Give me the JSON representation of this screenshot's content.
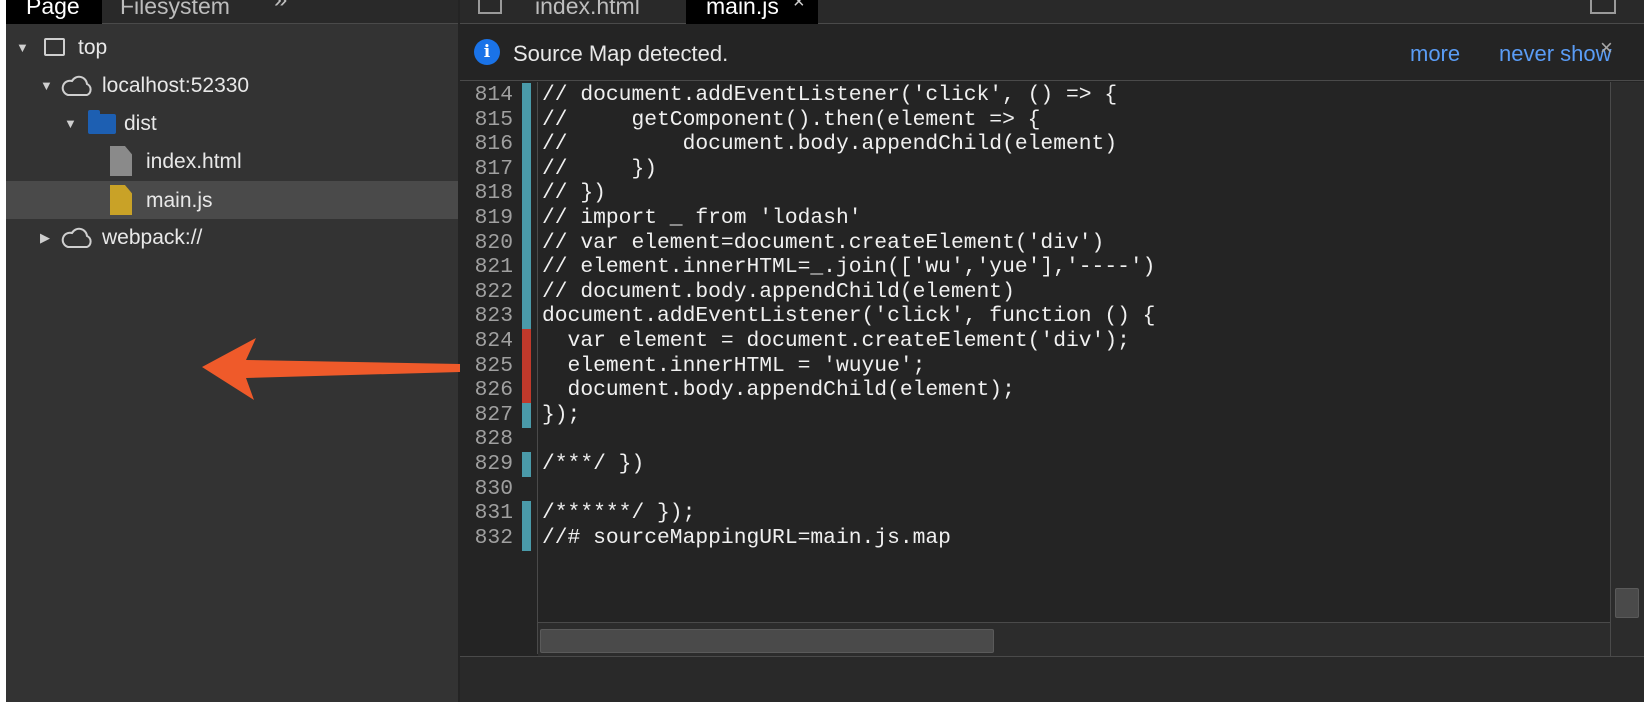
{
  "navigator": {
    "tabs": [
      "Page",
      "Filesystem"
    ],
    "more_label": "»",
    "menu_label": "⋮",
    "tree": [
      {
        "label": "top",
        "icon": "frame-icon",
        "expanded": true
      },
      {
        "label": "localhost:52330",
        "icon": "cloud-icon",
        "expanded": true
      },
      {
        "label": "dist",
        "icon": "folder-icon",
        "expanded": true
      },
      {
        "label": "index.html",
        "icon": "file-icon"
      },
      {
        "label": "main.js",
        "icon": "file-icon",
        "selected": true
      },
      {
        "label": "webpack://",
        "icon": "cloud-icon",
        "expanded": false
      }
    ],
    "tri_down": "▼",
    "tri_right": "▶"
  },
  "editor": {
    "tabs": [
      {
        "label": "index.html"
      },
      {
        "label": "main.js",
        "active": true
      }
    ],
    "close_label": "×",
    "infobar": {
      "icon": "i",
      "message": "Source Map detected.",
      "more_label": "more",
      "never_label": "never show",
      "close_label": "×"
    },
    "lines": [
      {
        "no": "814",
        "text": "// document.addEventListener('click', () => {",
        "marker": "teal"
      },
      {
        "no": "815",
        "text": "//     getComponent().then(element => {",
        "marker": "teal"
      },
      {
        "no": "816",
        "text": "//         document.body.appendChild(element)",
        "marker": "teal"
      },
      {
        "no": "817",
        "text": "//     })",
        "marker": "teal"
      },
      {
        "no": "818",
        "text": "// })",
        "marker": "teal"
      },
      {
        "no": "819",
        "text": "// import _ from 'lodash'",
        "marker": "teal"
      },
      {
        "no": "820",
        "text": "// var element=document.createElement('div')",
        "marker": "teal"
      },
      {
        "no": "821",
        "text": "// element.innerHTML=_.join(['wu','yue'],'----')",
        "marker": "teal"
      },
      {
        "no": "822",
        "text": "// document.body.appendChild(element)",
        "marker": "teal"
      },
      {
        "no": "823",
        "text": "document.addEventListener('click', function () {",
        "marker": "teal"
      },
      {
        "no": "824",
        "text": "  var element = document.createElement('div');",
        "marker": "red"
      },
      {
        "no": "825",
        "text": "  element.innerHTML = 'wuyue';",
        "marker": "red"
      },
      {
        "no": "826",
        "text": "  document.body.appendChild(element);",
        "marker": "red"
      },
      {
        "no": "827",
        "text": "});",
        "marker": "teal"
      },
      {
        "no": "828",
        "text": "",
        "marker": ""
      },
      {
        "no": "829",
        "text": "/***/ })",
        "marker": "teal"
      },
      {
        "no": "830",
        "text": "",
        "marker": ""
      },
      {
        "no": "831",
        "text": "/******/ });",
        "marker": "teal"
      },
      {
        "no": "832",
        "text": "//# sourceMappingURL=main.js.map",
        "marker": "teal"
      }
    ]
  },
  "colors": {
    "panel_bg": "#333333",
    "editor_bg": "#242424",
    "selection_bg": "#4a4a4a",
    "link_blue": "#5a9cf5",
    "info_blue": "#1a73e8",
    "marker_teal": "#4a9aa9",
    "marker_red": "#c0392b",
    "arrow_orange": "#ef5a2a",
    "folder_blue": "#1d5fb2",
    "js_file_yellow": "#c9a227"
  }
}
